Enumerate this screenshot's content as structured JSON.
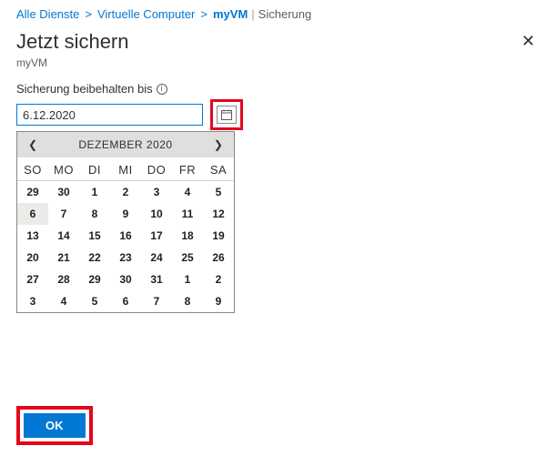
{
  "breadcrumb": {
    "all_services": "Alle Dienste",
    "virtual_computers": "Virtuelle Computer",
    "vm_name": "myVM",
    "section": "Sicherung"
  },
  "header": {
    "title": "Jetzt sichern",
    "subtitle": "myVM"
  },
  "field": {
    "label": "Sicherung beibehalten bis",
    "value": "6.12.2020"
  },
  "calendar": {
    "month_label": "DEZEMBER 2020",
    "dow": [
      "SO",
      "MO",
      "DI",
      "MI",
      "DO",
      "FR",
      "SA"
    ],
    "weeks": [
      [
        {
          "d": "29",
          "other": true
        },
        {
          "d": "30",
          "other": true
        },
        {
          "d": "1"
        },
        {
          "d": "2"
        },
        {
          "d": "3"
        },
        {
          "d": "4"
        },
        {
          "d": "5"
        }
      ],
      [
        {
          "d": "6",
          "sel": true
        },
        {
          "d": "7"
        },
        {
          "d": "8"
        },
        {
          "d": "9"
        },
        {
          "d": "10"
        },
        {
          "d": "11"
        },
        {
          "d": "12"
        }
      ],
      [
        {
          "d": "13"
        },
        {
          "d": "14"
        },
        {
          "d": "15"
        },
        {
          "d": "16"
        },
        {
          "d": "17"
        },
        {
          "d": "18"
        },
        {
          "d": "19"
        }
      ],
      [
        {
          "d": "20"
        },
        {
          "d": "21"
        },
        {
          "d": "22"
        },
        {
          "d": "23"
        },
        {
          "d": "24"
        },
        {
          "d": "25"
        },
        {
          "d": "26"
        }
      ],
      [
        {
          "d": "27"
        },
        {
          "d": "28"
        },
        {
          "d": "29"
        },
        {
          "d": "30"
        },
        {
          "d": "31"
        },
        {
          "d": "1",
          "other": true
        },
        {
          "d": "2",
          "other": true
        }
      ],
      [
        {
          "d": "3",
          "other": true
        },
        {
          "d": "4",
          "other": true
        },
        {
          "d": "5",
          "other": true
        },
        {
          "d": "6",
          "other": true
        },
        {
          "d": "7",
          "other": true
        },
        {
          "d": "8",
          "other": true
        },
        {
          "d": "9",
          "other": true
        }
      ]
    ]
  },
  "footer": {
    "ok": "OK"
  },
  "close_glyph": "✕",
  "info_glyph": "i"
}
